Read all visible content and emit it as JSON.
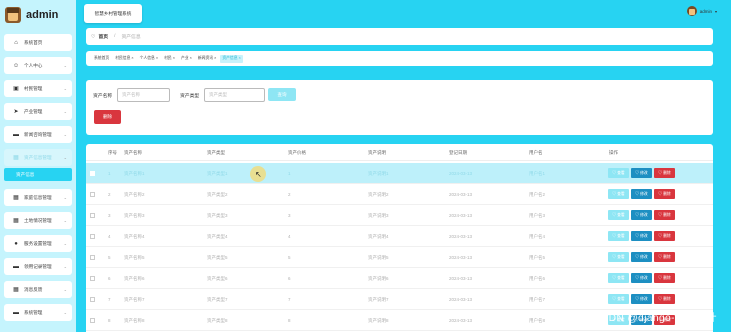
{
  "brand": {
    "name": "admin"
  },
  "header": {
    "system_button": "智慧乡村管理系统",
    "username": "admin"
  },
  "sidebar": {
    "items": [
      {
        "label": "系统首页",
        "icon": "home-icon",
        "glyph": "⌂",
        "chev": ""
      },
      {
        "label": "个人中心",
        "icon": "person-icon",
        "glyph": "☺",
        "chev": "⌄"
      },
      {
        "label": "村民管理",
        "icon": "villager-icon",
        "glyph": "▣",
        "chev": "⌄"
      },
      {
        "label": "产业管理",
        "icon": "send-icon",
        "glyph": "➤",
        "chev": "⌄"
      },
      {
        "label": "新闻咨询管理",
        "icon": "monitor-icon",
        "glyph": "▬",
        "chev": "⌄"
      },
      {
        "label": "资产信息管理",
        "icon": "grid-icon",
        "glyph": "▦",
        "chev": "⌄"
      },
      {
        "label": "家庭信息管理",
        "icon": "grid-icon",
        "glyph": "▦",
        "chev": "⌄"
      },
      {
        "label": "土地情况管理",
        "icon": "grid-icon",
        "glyph": "▦",
        "chev": "⌄"
      },
      {
        "label": "服务设置管理",
        "icon": "bulb-icon",
        "glyph": "●",
        "chev": "⌄"
      },
      {
        "label": "领用记录管理",
        "icon": "monitor-icon",
        "glyph": "▬",
        "chev": "⌄"
      },
      {
        "label": "消息反馈",
        "icon": "grid-icon",
        "glyph": "▦",
        "chev": "⌄"
      },
      {
        "label": "系统管理",
        "icon": "monitor-icon",
        "glyph": "▬",
        "chev": "⌄"
      }
    ],
    "sub_active": "资产信息"
  },
  "breadcrumb": {
    "home_icon": "♡",
    "home": "首页",
    "separator": "/",
    "current": "资产信息"
  },
  "tabs": [
    {
      "label": "系统首页",
      "active": false
    },
    {
      "label": "村民信息 ×",
      "active": false
    },
    {
      "label": "个人信息 ×",
      "active": false
    },
    {
      "label": "村民 ×",
      "active": false
    },
    {
      "label": "产业 ×",
      "active": false
    },
    {
      "label": "新闻资讯 ×",
      "active": false
    },
    {
      "label": "资产信息 ×",
      "active": true
    }
  ],
  "search": {
    "name_label": "资产名称",
    "name_placeholder": "资产名称",
    "type_label": "资产类型",
    "type_placeholder": "资产类型",
    "query_button": "查询",
    "delete_button": "删除"
  },
  "table": {
    "headers": [
      "序号",
      "资产名称",
      "资产类型",
      "资产价格",
      "资产说明",
      "登记日期",
      "用户名",
      "操作"
    ],
    "rows": [
      [
        "1",
        "资产名称1",
        "资产类型1",
        "1",
        "资产说明1",
        "2024-03-13",
        "用户名1"
      ],
      [
        "2",
        "资产名称2",
        "资产类型2",
        "2",
        "资产说明2",
        "2024-03-13",
        "用户名2"
      ],
      [
        "3",
        "资产名称3",
        "资产类型3",
        "3",
        "资产说明3",
        "2024-03-13",
        "用户名3"
      ],
      [
        "4",
        "资产名称4",
        "资产类型4",
        "4",
        "资产说明4",
        "2024-03-13",
        "用户名4"
      ],
      [
        "5",
        "资产名称5",
        "资产类型5",
        "5",
        "资产说明5",
        "2024-03-13",
        "用户名5"
      ],
      [
        "6",
        "资产名称6",
        "资产类型6",
        "6",
        "资产说明6",
        "2024-03-13",
        "用户名6"
      ],
      [
        "7",
        "资产名称7",
        "资产类型7",
        "7",
        "资产说明7",
        "2024-03-13",
        "用户名7"
      ],
      [
        "8",
        "资产名称8",
        "资产类型8",
        "8",
        "资产说明8",
        "2024-03-13",
        "用户名8"
      ]
    ],
    "selected_row": 0,
    "actions": {
      "view": "♡ 查看",
      "edit": "♡ 修改",
      "delete": "♡ 删除"
    }
  },
  "watermark": "CSDN @django-毕业设计",
  "colors": {
    "accent": "#27d3f2",
    "danger": "#d9363e",
    "edit": "#1d8fc2",
    "light_accent": "#8ee6f4"
  }
}
